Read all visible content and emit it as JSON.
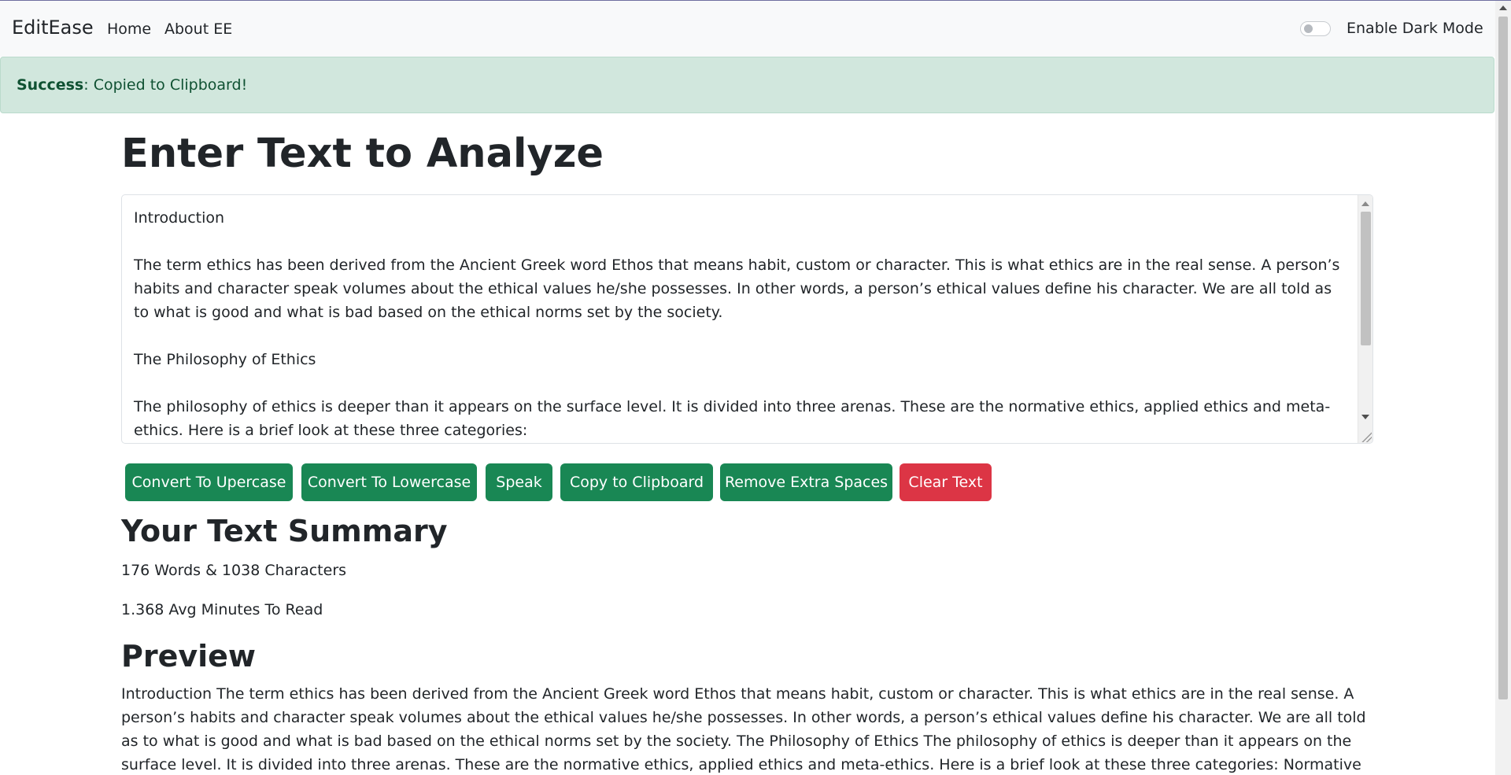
{
  "navbar": {
    "brand": "EditEase",
    "links": [
      "Home",
      "About EE"
    ],
    "dark_mode_label": "Enable Dark Mode",
    "dark_mode_on": false
  },
  "alert": {
    "strong": "Success",
    "message": ": Copied to Clipboard!"
  },
  "editor": {
    "title": "Enter Text to Analyze",
    "text": "Introduction\n\nThe term ethics has been derived from the Ancient Greek word Ethos that means habit, custom or character. This is what ethics are in the real sense. A person’s habits and character speak volumes about the ethical values he/she possesses. In other words, a person’s ethical values define his character. We are all told as to what is good and what is bad based on the ethical norms set by the society.\n\nThe Philosophy of Ethics\n\nThe philosophy of ethics is deeper than it appears on the surface level. It is divided into three arenas. These are the normative ethics, applied ethics and meta-ethics. Here is a brief look at these three categories:"
  },
  "buttons": {
    "uppercase": "Convert To Upercase",
    "lowercase": "Convert To Lowercase",
    "speak": "Speak",
    "copy": "Copy to Clipboard",
    "remove_spaces": "Remove Extra Spaces",
    "clear": "Clear Text"
  },
  "colors": {
    "green": "#198754",
    "red": "#dc3545",
    "alert_bg": "#d1e7dd"
  },
  "summary": {
    "heading": "Your Text Summary",
    "counts": "176 Words & 1038 Characters",
    "read_time": "1.368 Avg Minutes To Read"
  },
  "preview": {
    "heading": "Preview",
    "text": "Introduction The term ethics has been derived from the Ancient Greek word Ethos that means habit, custom or character. This is what ethics are in the real sense. A person’s habits and character speak volumes about the ethical values he/she possesses. In other words, a person’s ethical values define his character. We are all told as to what is good and what is bad based on the ethical norms set by the society. The Philosophy of Ethics The philosophy of ethics is deeper than it appears on the surface level. It is divided into three arenas. These are the normative ethics, applied ethics and meta-ethics. Here is a brief look at these three categories: Normative Ethics: It deals with the content of moral judgement. It"
  }
}
